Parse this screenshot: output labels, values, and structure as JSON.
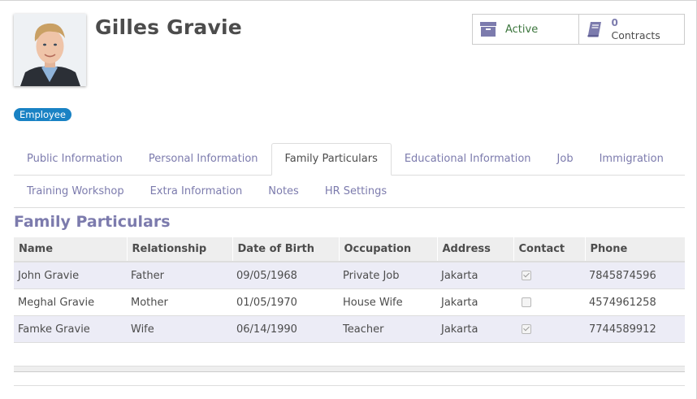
{
  "employee": {
    "name": "Gilles Gravie",
    "tag": "Employee"
  },
  "smart_buttons": {
    "active_label": "Active",
    "contracts_count": "0",
    "contracts_label": "Contracts"
  },
  "tabs": {
    "row1": [
      "Public Information",
      "Personal Information",
      "Family Particulars",
      "Educational Information",
      "Job",
      "Immigration"
    ],
    "row2": [
      "Training Workshop",
      "Extra Information",
      "Notes",
      "HR Settings"
    ],
    "active": "Family Particulars"
  },
  "section": {
    "title": "Family Particulars"
  },
  "table": {
    "headers": [
      "Name",
      "Relationship",
      "Date of Birth",
      "Occupation",
      "Address",
      "Contact",
      "Phone"
    ],
    "rows": [
      {
        "name": "John Gravie",
        "relationship": "Father",
        "dob": "09/05/1968",
        "occupation": "Private Job",
        "address": "Jakarta",
        "contact": true,
        "phone": "7845874596"
      },
      {
        "name": "Meghal Gravie",
        "relationship": "Mother",
        "dob": "01/05/1970",
        "occupation": "House Wife",
        "address": "Jakarta",
        "contact": false,
        "phone": "4574961258"
      },
      {
        "name": "Famke Gravie",
        "relationship": "Wife",
        "dob": "06/14/1990",
        "occupation": "Teacher",
        "address": "Jakarta",
        "contact": true,
        "phone": "7744589912"
      }
    ]
  },
  "icons": {
    "active": "archive-box-icon",
    "contracts": "book-icon"
  },
  "colors": {
    "accent": "#7c7bad",
    "badge": "#1982c4",
    "active_text": "#3c763d",
    "row_highlight": "#ececf6"
  }
}
